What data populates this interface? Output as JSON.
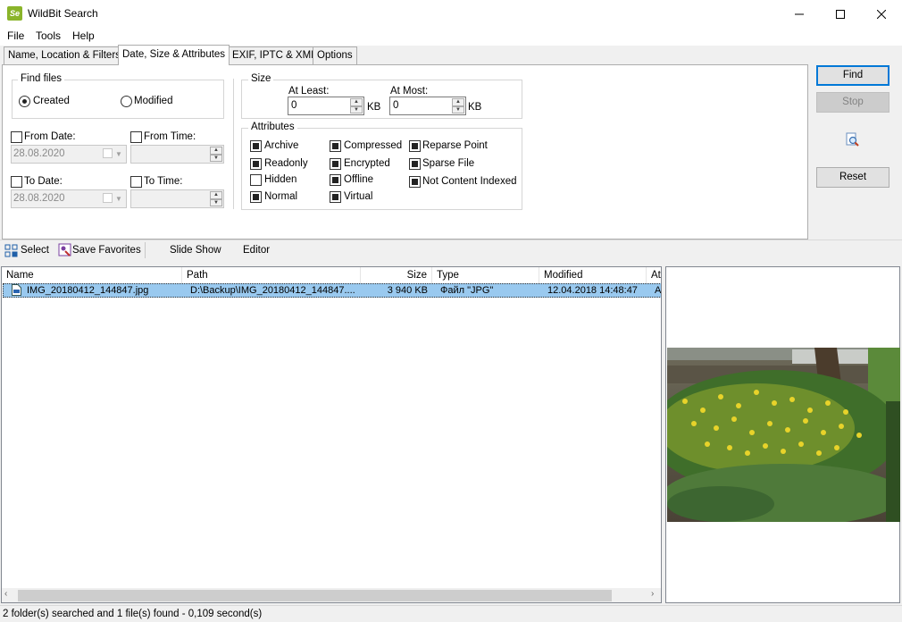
{
  "window": {
    "title": "WildBit Search",
    "icon_text": "Se"
  },
  "menu": [
    "File",
    "Tools",
    "Help"
  ],
  "tabs": [
    "Name, Location & Filters",
    "Date, Size & Attributes",
    "EXIF, IPTC & XMP",
    "Options"
  ],
  "find_files": {
    "label": "Find files",
    "created": "Created",
    "modified": "Modified",
    "from_date_label": "From Date:",
    "from_date_value": "28.08.2020",
    "from_time_label": "From Time:",
    "to_date_label": "To Date:",
    "to_date_value": "28.08.2020",
    "to_time_label": "To Time:"
  },
  "size": {
    "label": "Size",
    "at_least_label": "At Least:",
    "at_least_value": "0",
    "at_most_label": "At Most:",
    "at_most_value": "0",
    "unit": "KB"
  },
  "attributes": {
    "label": "Attributes",
    "items": [
      {
        "name": "Archive",
        "checked": true
      },
      {
        "name": "Compressed",
        "checked": true
      },
      {
        "name": "Reparse Point",
        "checked": true
      },
      {
        "name": "Readonly",
        "checked": true
      },
      {
        "name": "Encrypted",
        "checked": true
      },
      {
        "name": "Sparse File",
        "checked": true
      },
      {
        "name": "Hidden",
        "checked": false
      },
      {
        "name": "Offline",
        "checked": true
      },
      {
        "name": "Not Content Indexed",
        "checked": true
      },
      {
        "name": "Normal",
        "checked": true
      },
      {
        "name": "Virtual",
        "checked": true
      }
    ]
  },
  "buttons": {
    "find": "Find",
    "stop": "Stop",
    "reset": "Reset"
  },
  "toolbar": {
    "select": "Select",
    "save_favorites": "Save Favorites",
    "slide_show": "Slide Show",
    "editor": "Editor"
  },
  "list": {
    "columns": [
      "Name",
      "Path",
      "Size",
      "Type",
      "Modified",
      "At"
    ],
    "rows": [
      {
        "name": "IMG_20180412_144847.jpg",
        "path": "D:\\Backup\\IMG_20180412_144847....",
        "size": "3 940 KB",
        "type": "Файл \"JPG\"",
        "modified": "12.04.2018 14:48:47",
        "attr": "A"
      }
    ]
  },
  "status": "2 folder(s) searched and 1 file(s) found - 0,109 second(s)"
}
